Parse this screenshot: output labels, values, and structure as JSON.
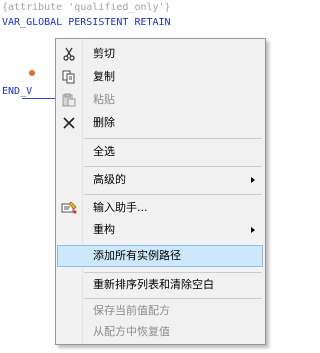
{
  "editor": {
    "line1": "{attribute 'qualified_only'}",
    "line2": "VAR_GLOBAL PERSISTENT RETAIN",
    "line3": "END_V"
  },
  "context_menu": {
    "items": [
      {
        "label": "剪切",
        "icon": "scissors-icon",
        "enabled": true
      },
      {
        "label": "复制",
        "icon": "copy-icon",
        "enabled": true
      },
      {
        "label": "粘贴",
        "icon": "paste-icon",
        "enabled": false
      },
      {
        "label": "删除",
        "icon": "delete-x-icon",
        "enabled": true
      },
      {
        "label": "全选",
        "enabled": true
      },
      {
        "label": "高级的",
        "enabled": true,
        "submenu": true
      },
      {
        "label": "输入助手...",
        "icon": "input-assistant-icon",
        "enabled": true
      },
      {
        "label": "重构",
        "enabled": true,
        "submenu": true
      },
      {
        "label": "添加所有实例路径",
        "enabled": true,
        "highlighted": true
      },
      {
        "label": "重新排序列表和清除空白",
        "enabled": true
      },
      {
        "label": "保存当前值配方",
        "enabled": false
      },
      {
        "label": "从配方中恢复值",
        "enabled": false
      }
    ]
  },
  "colors": {
    "comment": "#a3a3a3",
    "keyword": "#1d33b7",
    "highlight": "#cde8fa",
    "disabled_text": "#8d8d8d"
  }
}
